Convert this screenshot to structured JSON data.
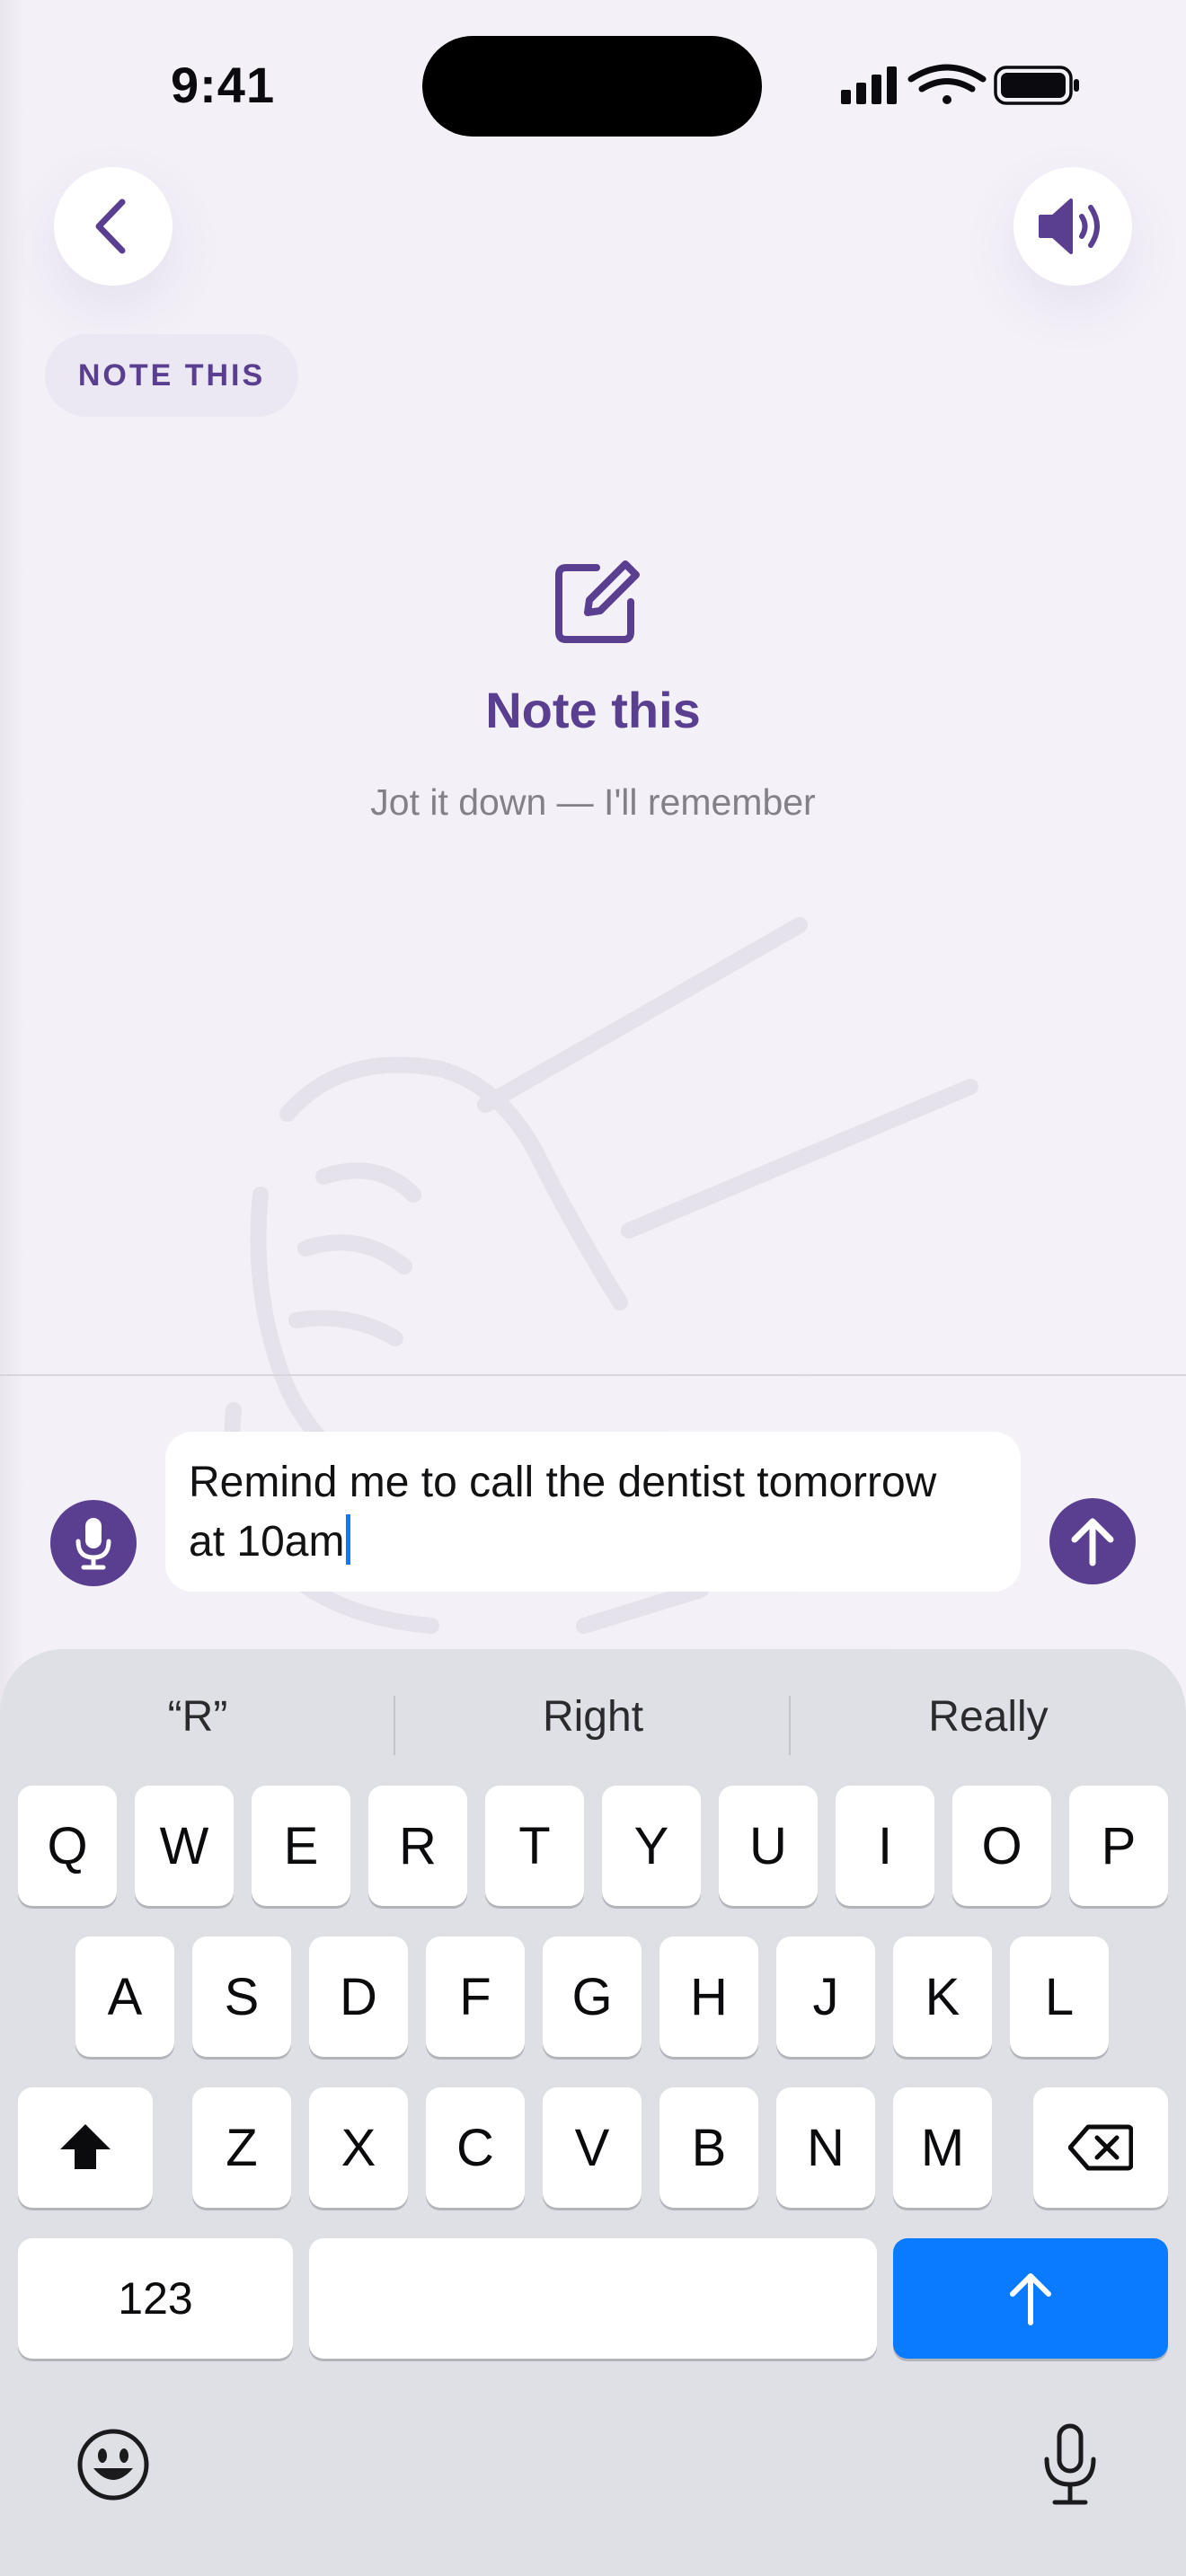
{
  "status_bar": {
    "time": "9:41"
  },
  "header": {
    "back_icon": "chevron-left-icon",
    "sound_icon": "speaker-volume-icon",
    "chip_label": "NOTE THIS"
  },
  "hero": {
    "icon": "edit-note-icon",
    "title": "Note this",
    "subtitle": "Jot it down — I'll remember"
  },
  "composer": {
    "mic_icon": "microphone-icon",
    "send_icon": "arrow-up-icon",
    "text_line1": "Remind me to call the dentist tomorrow",
    "text_line2": "at 10am"
  },
  "keyboard": {
    "suggestions": [
      "“R”",
      "Right",
      "Really"
    ],
    "row1": [
      "Q",
      "W",
      "E",
      "R",
      "T",
      "Y",
      "U",
      "I",
      "O",
      "P"
    ],
    "row2": [
      "A",
      "S",
      "D",
      "F",
      "G",
      "H",
      "J",
      "K",
      "L"
    ],
    "row3": [
      "Z",
      "X",
      "C",
      "V",
      "B",
      "N",
      "M"
    ],
    "numbers_label": "123",
    "space_label": "",
    "return_icon": "arrow-up-icon",
    "shift_icon": "shift-icon",
    "delete_icon": "backspace-icon",
    "emoji_icon": "emoji-icon",
    "dictation_icon": "microphone-icon"
  },
  "colors": {
    "accent": "#5a3e90",
    "background": "#f3f0f8",
    "keyboard_bg": "#dfe0e6",
    "return_key": "#0a7aff"
  }
}
